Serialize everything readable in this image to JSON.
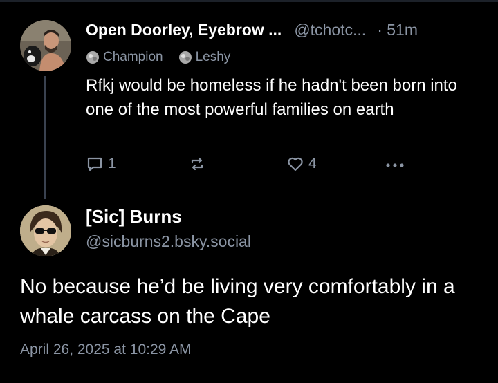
{
  "colors": {
    "background": "#000000",
    "text": "#ffffff",
    "muted": "#8b95a4",
    "thread_line": "#3a4250"
  },
  "parent_post": {
    "display_name": "Open Doorley, Eyebrow ...",
    "handle": "@tchotc...",
    "time": "· 51m",
    "badges": [
      {
        "icon": "badge-icon",
        "label": "Champion"
      },
      {
        "icon": "badge-icon",
        "label": "Leshy"
      }
    ],
    "text": "Rfkj would be homeless if he hadn't been born into one of the most powerful families on earth",
    "actions": {
      "reply_icon": "reply-icon",
      "reply_count": "1",
      "repost_icon": "repost-icon",
      "like_icon": "heart-icon",
      "like_count": "4",
      "more_icon": "more-options-icon"
    }
  },
  "main_post": {
    "display_name": "[Sic] Burns",
    "handle": "@sicburns2.bsky.social",
    "text": "No because he’d be living very comfortably in a whale carcass on the Cape",
    "date": "April 26, 2025 at 10:29 AM"
  }
}
